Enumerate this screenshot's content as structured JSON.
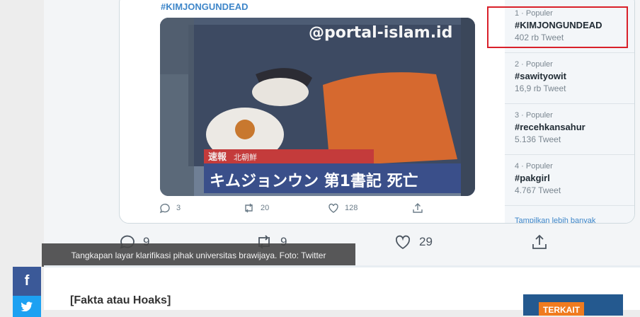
{
  "tweet": {
    "hashtag": "#KIMJONGUNDEAD",
    "watermark": "@portal-islam.id",
    "tv_banner_small": "速報",
    "tv_banner_label": "北朝鮮",
    "tv_headline": "キムジョンウン 第1書記 死亡",
    "replies": "3",
    "retweets": "20",
    "likes": "128"
  },
  "trends": [
    {
      "meta": "1 · Populer",
      "name": "#KIMJONGUNDEAD",
      "count": "402 rb Tweet"
    },
    {
      "meta": "2 · Populer",
      "name": "#sawityowit",
      "count": "16,9 rb Tweet"
    },
    {
      "meta": "3 · Populer",
      "name": "#recehkansahur",
      "count": "5.136 Tweet"
    },
    {
      "meta": "4 · Populer",
      "name": "#pakgirl",
      "count": "4.767 Tweet"
    }
  ],
  "trends_more": "Tampilkan lebih banyak",
  "outer_actions": {
    "replies": "9",
    "retweets": "9",
    "likes": "29"
  },
  "caption": "Tangkapan layar klarifikasi pihak universitas brawijaya. Foto: Twitter",
  "article": {
    "heading": "[Fakta atau Hoaks]"
  },
  "share": {
    "facebook": "f"
  },
  "related": {
    "tag": "TERKAIT"
  },
  "colors": {
    "highlight": "#d9202a",
    "facebook": "#3b5998",
    "twitter": "#1da1f2",
    "accent": "#f07b1f"
  }
}
